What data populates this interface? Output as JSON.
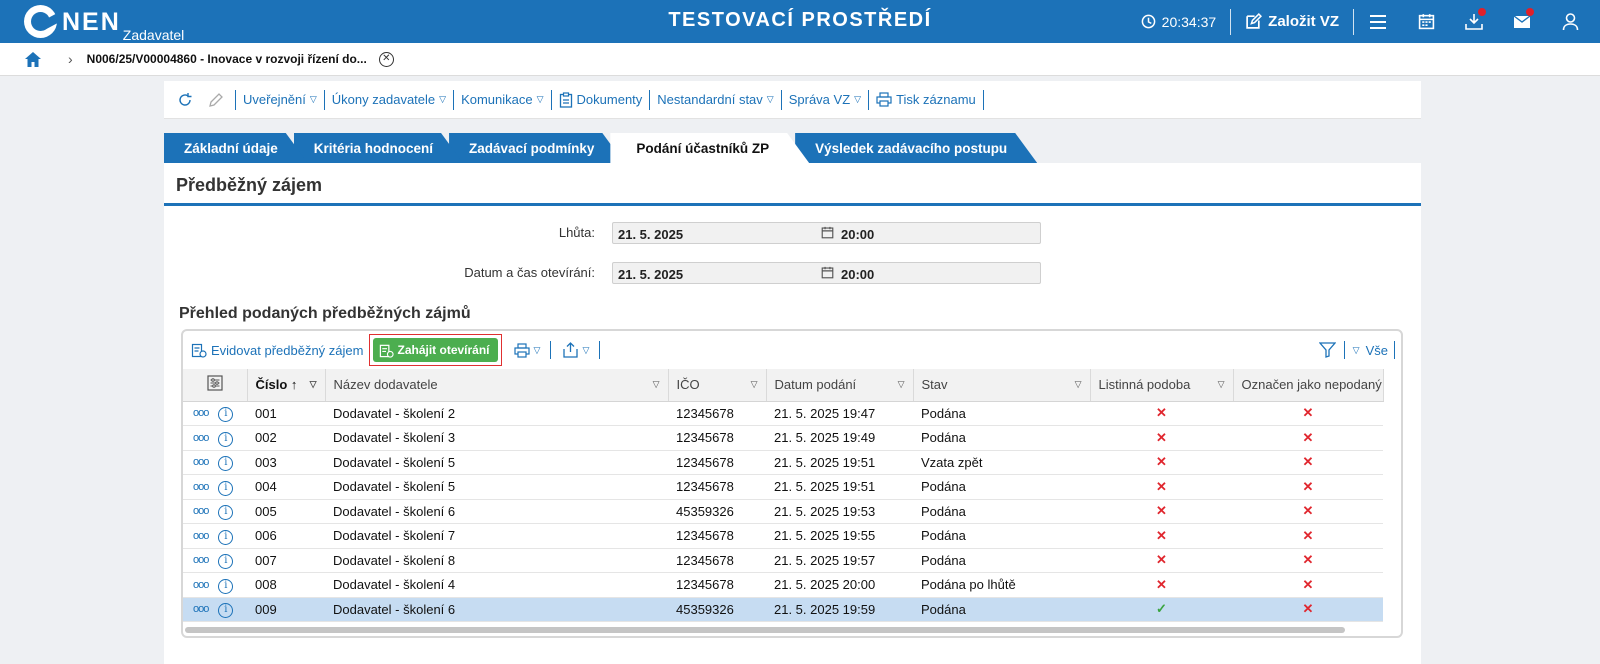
{
  "header": {
    "logo_text": "NEN",
    "logo_sub": "Zadavatel",
    "env_title": "TESTOVACÍ PROSTŘEDÍ",
    "clock": "20:34:37",
    "create_label": "Založit VZ",
    "icons": [
      "clock-icon",
      "edit-icon",
      "menu-icon",
      "calendar-icon",
      "download-icon",
      "mail-icon",
      "user-icon"
    ]
  },
  "breadcrumb": {
    "item": "N006/25/V00004860 - Inovace v rozvoji řízení do..."
  },
  "toolbar": {
    "items": [
      {
        "label": "Uveřejnění"
      },
      {
        "label": "Úkony zadavatele"
      },
      {
        "label": "Komunikace"
      },
      {
        "label": "Dokumenty"
      },
      {
        "label": "Nestandardní stav"
      },
      {
        "label": "Správa VZ"
      },
      {
        "label": "Tisk záznamu"
      }
    ]
  },
  "tabs": [
    {
      "label": "Základní údaje"
    },
    {
      "label": "Kritéria hodnocení"
    },
    {
      "label": "Zadávací podmínky"
    },
    {
      "label": "Podání účastníků ZP"
    },
    {
      "label": "Výsledek zadávacího postupu"
    }
  ],
  "active_tab": "Podání účastníků ZP",
  "section": {
    "title": "Předběžný zájem",
    "fields": [
      {
        "label": "Lhůta:",
        "date": "21. 5. 2025",
        "time": "20:00"
      },
      {
        "label": "Datum a čas otevírání:",
        "date": "21. 5. 2025",
        "time": "20:00"
      }
    ]
  },
  "grid": {
    "title": "Přehled podaných předběžných zájmů",
    "evidovat_label": "Evidovat předběžný zájem",
    "zahajit_label": "Zahájit otevírání",
    "filter_all_label": "Vše",
    "columns": [
      "Číslo",
      "Název dodavatele",
      "IČO",
      "Datum podání",
      "Stav",
      "Listinná podoba",
      "Označen jako nepodaný"
    ],
    "rows": [
      {
        "cislo": "001",
        "nazev": "Dodavatel - školení 2",
        "ico": "12345678",
        "datum": "21. 5. 2025 19:47",
        "stav": "Podána",
        "listinna": "✕",
        "nepodany": "✕"
      },
      {
        "cislo": "002",
        "nazev": "Dodavatel - školení 3",
        "ico": "12345678",
        "datum": "21. 5. 2025 19:49",
        "stav": "Podána",
        "listinna": "✕",
        "nepodany": "✕"
      },
      {
        "cislo": "003",
        "nazev": "Dodavatel - školení 5",
        "ico": "12345678",
        "datum": "21. 5. 2025 19:51",
        "stav": "Vzata zpět",
        "listinna": "✕",
        "nepodany": "✕"
      },
      {
        "cislo": "004",
        "nazev": "Dodavatel - školení 5",
        "ico": "12345678",
        "datum": "21. 5. 2025 19:51",
        "stav": "Podána",
        "listinna": "✕",
        "nepodany": "✕"
      },
      {
        "cislo": "005",
        "nazev": "Dodavatel - školení 6",
        "ico": "45359326",
        "datum": "21. 5. 2025 19:53",
        "stav": "Podána",
        "listinna": "✕",
        "nepodany": "✕"
      },
      {
        "cislo": "006",
        "nazev": "Dodavatel - školení 7",
        "ico": "12345678",
        "datum": "21. 5. 2025 19:55",
        "stav": "Podána",
        "listinna": "✕",
        "nepodany": "✕"
      },
      {
        "cislo": "007",
        "nazev": "Dodavatel - školení 8",
        "ico": "12345678",
        "datum": "21. 5. 2025 19:57",
        "stav": "Podána",
        "listinna": "✕",
        "nepodany": "✕"
      },
      {
        "cislo": "008",
        "nazev": "Dodavatel - školení 4",
        "ico": "12345678",
        "datum": "21. 5. 2025 20:00",
        "stav": "Podána po lhůtě",
        "listinna": "✕",
        "nepodany": "✕"
      },
      {
        "cislo": "009",
        "nazev": "Dodavatel - školení 6",
        "ico": "45359326",
        "datum": "21. 5. 2025 19:59",
        "stav": "Podána",
        "listinna": "✓",
        "nepodany": "✕",
        "selected": true
      }
    ]
  },
  "colors": {
    "brand": "#1c72b8",
    "success": "#4cae4f",
    "error": "#e0262e",
    "selected_row": "#c6dcf2"
  }
}
